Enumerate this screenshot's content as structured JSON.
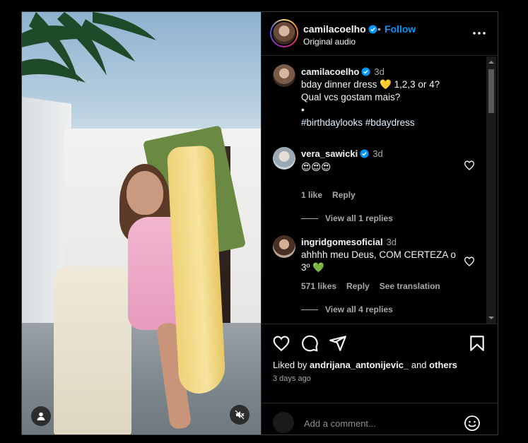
{
  "post": {
    "author": "camilacoelho",
    "verified": true,
    "follow_label": "Follow",
    "audio": "Original audio",
    "separator": "•"
  },
  "caption": {
    "username": "camilacoelho",
    "time": "3d",
    "line1": "bday dinner dress 💛 1,2,3 or 4?",
    "line2": "Qual vcs gostam mais?",
    "line3": "•",
    "hashtags": "#birthdaylooks #bdaydress"
  },
  "comments": [
    {
      "username": "vera_sawicki",
      "verified": true,
      "time": "3d",
      "text": "😍😍😍",
      "likes": "1 like",
      "reply_label": "Reply",
      "view_replies": "View all 1 replies"
    },
    {
      "username": "ingridgomesoficial",
      "verified": false,
      "time": "3d",
      "text_line1": "ahhhh meu Deus, COM CERTEZA o",
      "text_line2": "3º 💚",
      "likes": "571 likes",
      "reply_label": "Reply",
      "translation_label": "See translation",
      "view_replies": "View all 4 replies"
    },
    {
      "username": "ingridgomesoficial",
      "time": "3d"
    }
  ],
  "actions": {
    "liked_by_prefix": "Liked by",
    "liked_by_user": "andrijana_antonijevic_",
    "liked_by_and": "and",
    "liked_by_others": "others",
    "posted_ago": "3 days ago"
  },
  "composer": {
    "placeholder": "Add a comment..."
  },
  "icons": {
    "verified": "verified-badge-icon",
    "more": "more-options-icon",
    "like": "heart-icon",
    "comment": "comment-icon",
    "share": "share-icon",
    "save": "bookmark-icon",
    "emoji": "emoji-icon",
    "mute": "speaker-muted-icon",
    "user_tags": "user-tag-icon"
  },
  "colors": {
    "accent": "#0095f6",
    "verified": "#0095f6",
    "background": "#000000",
    "muted_text": "#a8a8a8"
  }
}
